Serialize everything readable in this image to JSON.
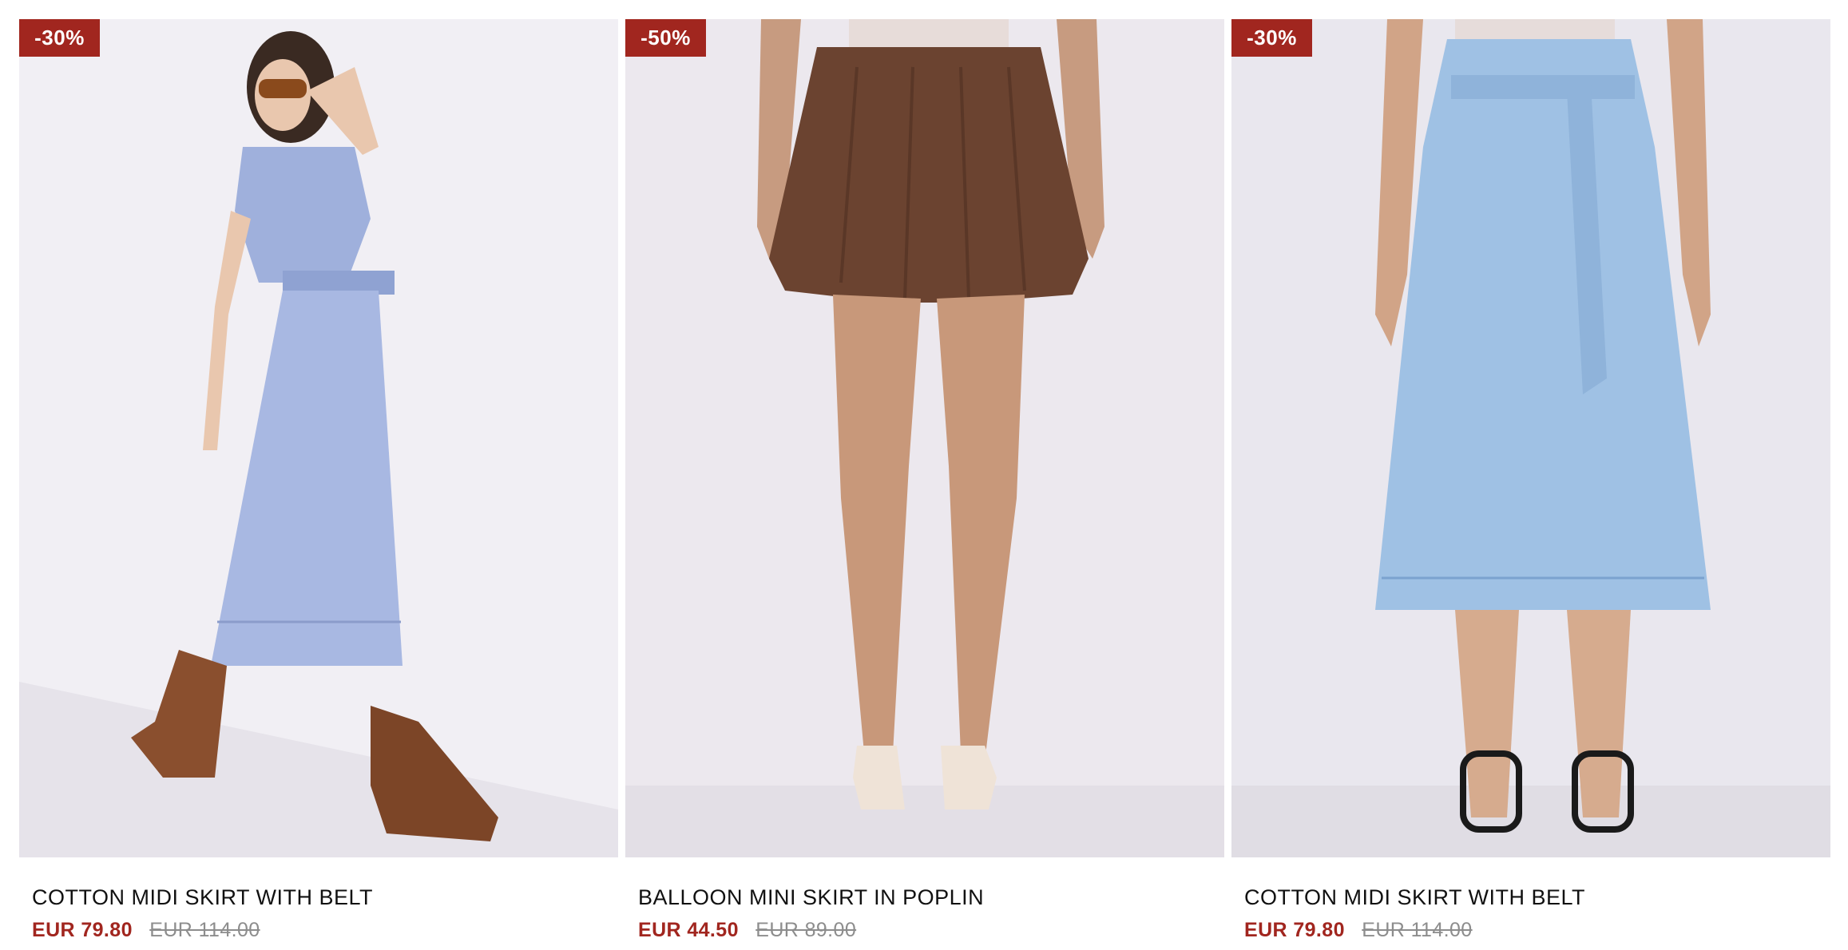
{
  "products": [
    {
      "discount": "-30%",
      "title": "COTTON MIDI SKIRT WITH BELT",
      "sale_price": "EUR 79.80",
      "original_price": "EUR 114.00"
    },
    {
      "discount": "-50%",
      "title": "BALLOON MINI SKIRT IN POPLIN",
      "sale_price": "EUR 44.50",
      "original_price": "EUR 89.00"
    },
    {
      "discount": "-30%",
      "title": "COTTON MIDI SKIRT WITH BELT",
      "sale_price": "EUR 79.80",
      "original_price": "EUR 114.00"
    }
  ],
  "colors": {
    "badge": "#a1261f",
    "sale_price": "#a1261f",
    "original_price": "#8d8d8d"
  }
}
